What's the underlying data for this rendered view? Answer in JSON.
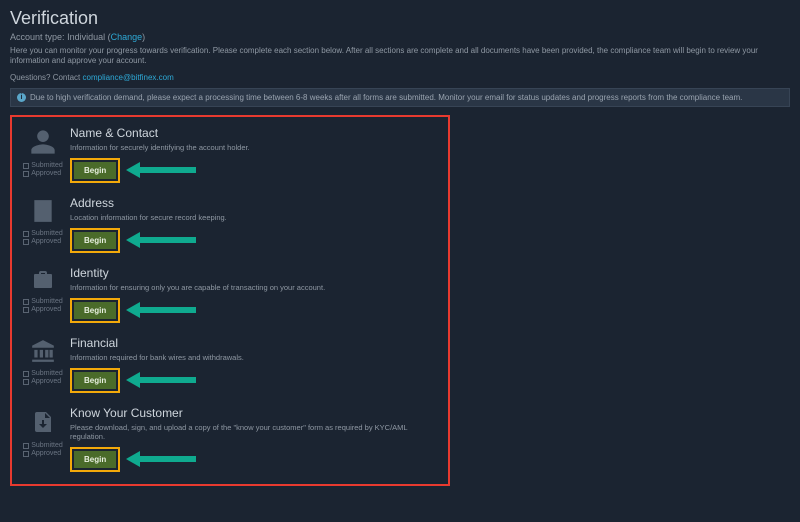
{
  "header": {
    "title": "Verification",
    "accountTypeLabel": "Account type:",
    "accountType": "Individual",
    "changeLabel": "Change",
    "intro": "Here you can monitor your progress towards verification. Please complete each section below. After all sections are complete and all documents have been provided, the compliance team will begin to review your information and approve your account.",
    "questionsLabel": "Questions? Contact",
    "contactEmail": "compliance@bitfinex.com"
  },
  "notice": {
    "iconLabel": "i",
    "text": "Due to high verification demand, please expect a processing time between 6-8 weeks after all forms are submitted. Monitor your email for status updates and progress reports from the compliance team."
  },
  "statusLabels": {
    "submitted": "Submitted",
    "approved": "Approved"
  },
  "beginLabel": "Begin",
  "sections": [
    {
      "key": "name-contact",
      "icon": "user-icon",
      "title": "Name & Contact",
      "desc": "Information for securely identifying the account holder."
    },
    {
      "key": "address",
      "icon": "building-icon",
      "title": "Address",
      "desc": "Location information for secure record keeping."
    },
    {
      "key": "identity",
      "icon": "briefcase-icon",
      "title": "Identity",
      "desc": "Information for ensuring only you are capable of transacting on your account."
    },
    {
      "key": "financial",
      "icon": "bank-icon",
      "title": "Financial",
      "desc": "Information required for bank wires and withdrawals."
    },
    {
      "key": "kyc",
      "icon": "file-pdf-icon",
      "title": "Know Your Customer",
      "desc": "Please download, sign, and upload a copy of the \"know your customer\" form as required by KYC/AML regulation."
    }
  ]
}
